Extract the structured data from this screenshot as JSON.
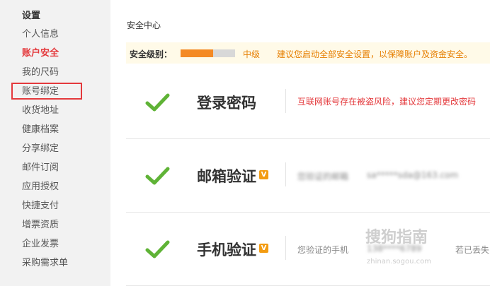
{
  "sidebar": {
    "title": "设置",
    "items": [
      {
        "label": "个人信息"
      },
      {
        "label": "账户安全",
        "active": true
      },
      {
        "label": "我的尺码"
      },
      {
        "label": "账号绑定"
      },
      {
        "label": "收货地址"
      },
      {
        "label": "健康档案"
      },
      {
        "label": "分享绑定"
      },
      {
        "label": "邮件订阅"
      },
      {
        "label": "应用授权"
      },
      {
        "label": "快捷支付"
      },
      {
        "label": "增票资质"
      },
      {
        "label": "企业发票"
      },
      {
        "label": "采购需求单"
      }
    ]
  },
  "main": {
    "title": "安全中心",
    "security_level": {
      "label": "安全级别：",
      "level": "中级",
      "progress": 0.6,
      "advice": "建议您启动全部安全设置，以保障账户及资金安全。"
    },
    "items": [
      {
        "name": "登录密码",
        "status_icon": "check-icon",
        "description": "互联网账号存在被盗风险，建议您定期更改密码"
      },
      {
        "name": "邮箱验证",
        "badge": "V",
        "status_icon": "check-icon",
        "description_prefix": "您验证的邮箱",
        "description_masked": "sa*****sda@163.com"
      },
      {
        "name": "手机验证",
        "badge": "V",
        "status_icon": "check-icon",
        "description_prefix": "您验证的手机",
        "description_masked": "138****6789",
        "description_suffix": "若已丢失"
      }
    ]
  },
  "watermark": {
    "text": "搜狗指南",
    "url": "zhinan.sogou.com"
  },
  "colors": {
    "accent": "#e4393c",
    "warning": "#e67e00",
    "progress": "#f48a24",
    "check": "#5fb336"
  }
}
